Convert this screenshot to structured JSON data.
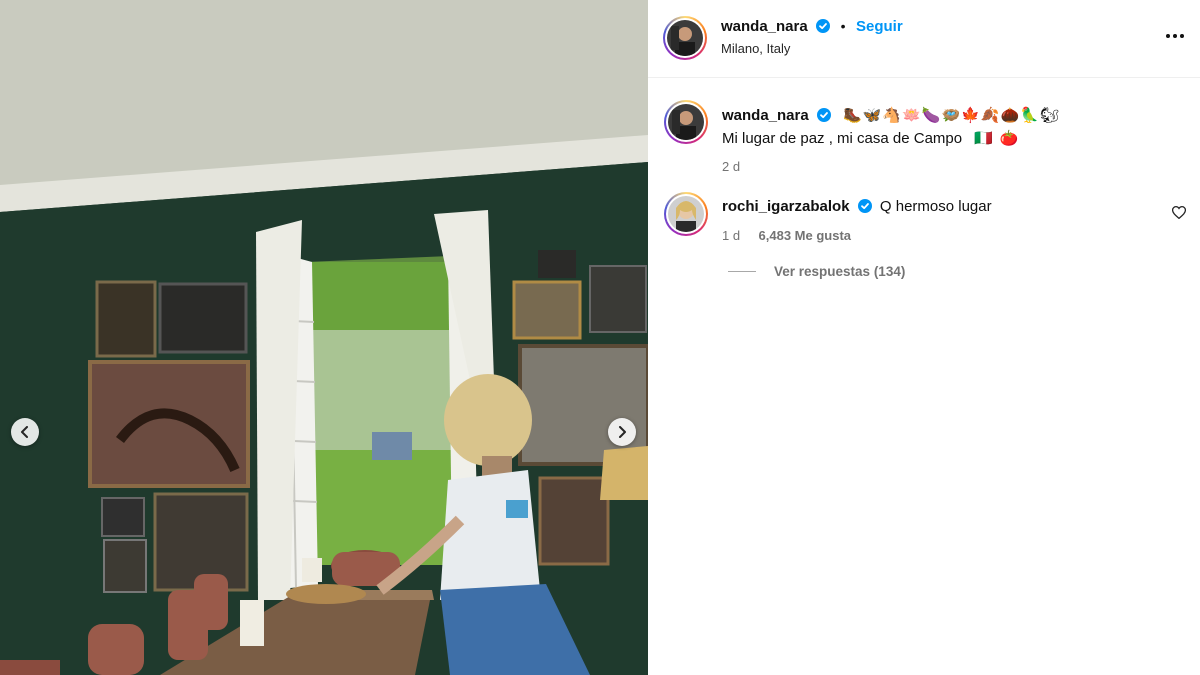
{
  "post": {
    "author": {
      "username": "wanda_nara",
      "verified": true,
      "follow_label": "Seguir",
      "location": "Milano, Italy"
    },
    "caption": {
      "username": "wanda_nara",
      "emojis": "🥾🦋🐴🪷🍆🪺🍁🍂🌰🦜🐿",
      "text": "Mi lugar de paz , mi casa de Campo",
      "text_emojis": "🇮🇹 🍅",
      "age": "2 d"
    },
    "comments": [
      {
        "username": "rochi_igarzabalok",
        "verified": true,
        "text": "Q hermoso lugar",
        "age": "1 d",
        "likes": "6,483 Me gusta",
        "replies_label": "Ver respuestas (134)"
      }
    ]
  },
  "colors": {
    "accent": "#0095f6",
    "verified": "#0095f6",
    "wall": "#1f3a2d",
    "secondary_text": "#737373"
  },
  "icons": {
    "prev": "chevron-left-icon",
    "next": "chevron-right-icon",
    "more": "more-options-icon",
    "like": "heart-icon"
  }
}
